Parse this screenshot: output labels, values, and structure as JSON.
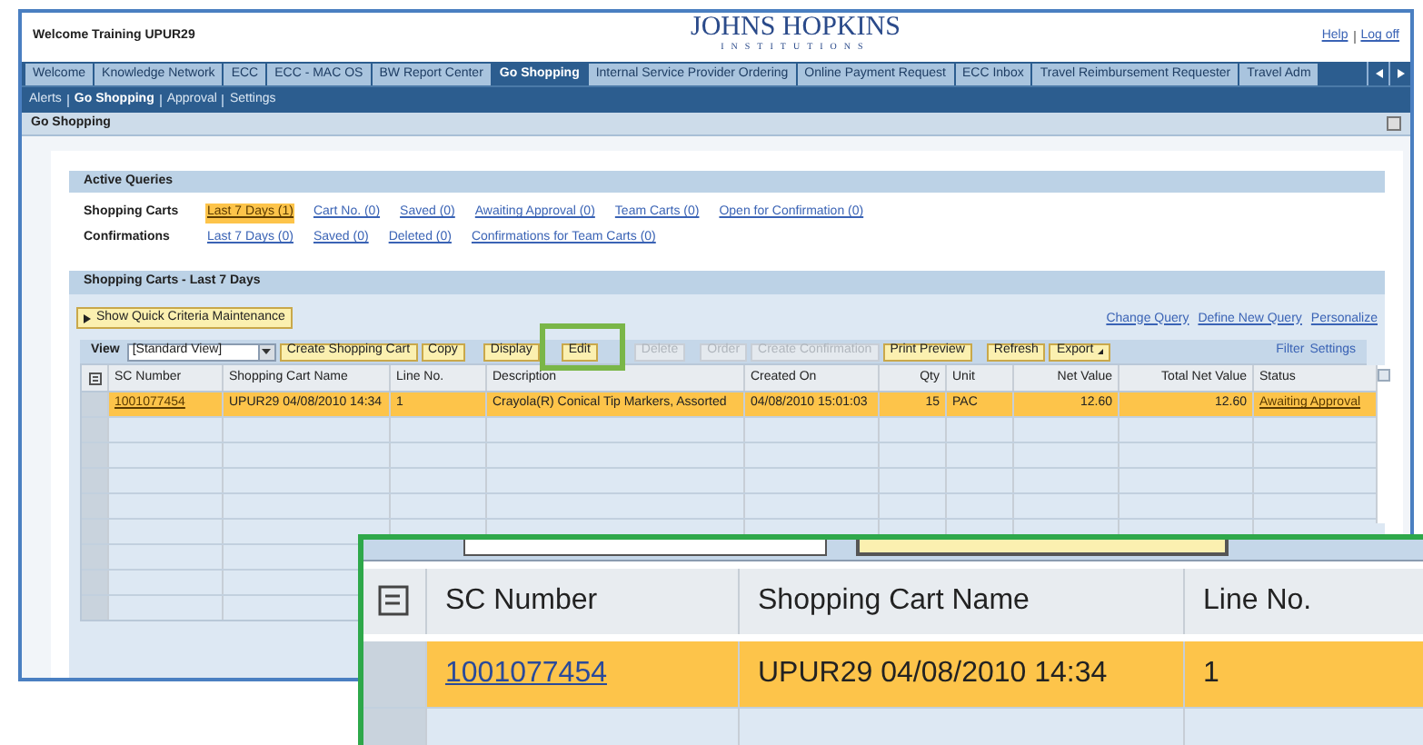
{
  "header": {
    "welcome": "Welcome Training UPUR29",
    "logo_title": "JOHNS HOPKINS",
    "logo_subtitle": "INSTITUTIONS",
    "links": [
      "Help",
      "Log off"
    ]
  },
  "tabs": [
    {
      "label": "Welcome",
      "selected": false
    },
    {
      "label": "Knowledge Network",
      "selected": false
    },
    {
      "label": "ECC",
      "selected": false
    },
    {
      "label": "ECC - MAC OS",
      "selected": false
    },
    {
      "label": "BW Report Center",
      "selected": false
    },
    {
      "label": "Go Shopping",
      "selected": true
    },
    {
      "label": "Internal Service Provider Ordering",
      "selected": false
    },
    {
      "label": "Online Payment Request",
      "selected": false
    },
    {
      "label": "ECC Inbox",
      "selected": false
    },
    {
      "label": "Travel Reimbursement Requester",
      "selected": false
    },
    {
      "label": "Travel Adm",
      "selected": false
    }
  ],
  "subnav": [
    {
      "label": "Alerts",
      "selected": false
    },
    {
      "label": "Go Shopping",
      "selected": true
    },
    {
      "label": "Approval",
      "selected": false
    },
    {
      "label": "Settings",
      "selected": false
    }
  ],
  "page_title": "Go Shopping",
  "active_queries": {
    "title": "Active Queries",
    "rows": [
      {
        "label": "Shopping Carts",
        "links": [
          {
            "label": "Last 7 Days (1)",
            "selected": true
          },
          {
            "label": "Cart No. (0)",
            "selected": false
          },
          {
            "label": "Saved (0)",
            "selected": false
          },
          {
            "label": "Awaiting Approval (0)",
            "selected": false
          },
          {
            "label": "Team Carts (0)",
            "selected": false
          },
          {
            "label": "Open for Confirmation (0)",
            "selected": false
          }
        ]
      },
      {
        "label": "Confirmations",
        "links": [
          {
            "label": "Last 7 Days (0)",
            "selected": false
          },
          {
            "label": "Saved (0)",
            "selected": false
          },
          {
            "label": "Deleted (0)",
            "selected": false
          },
          {
            "label": "Confirmations for Team Carts (0)",
            "selected": false
          }
        ]
      }
    ]
  },
  "carts": {
    "title": "Shopping Carts - Last 7 Days",
    "quick_criteria": "Show Quick Criteria Maintenance",
    "query_links": [
      "Change Query",
      "Define New Query",
      "Personalize"
    ],
    "view_label": "View",
    "view_value": "[Standard View]",
    "toolbar": [
      {
        "label": "Create Shopping Cart",
        "disabled": false
      },
      {
        "label": "Copy",
        "disabled": false
      },
      {
        "label": "Display",
        "disabled": false
      },
      {
        "label": "Edit",
        "disabled": false
      },
      {
        "label": "Delete",
        "disabled": true
      },
      {
        "label": "Order",
        "disabled": true
      },
      {
        "label": "Create Confirmation",
        "disabled": true
      },
      {
        "label": "Print Preview",
        "disabled": false
      },
      {
        "label": "Refresh",
        "disabled": false
      },
      {
        "label": "Export",
        "disabled": false
      }
    ],
    "right_links": [
      "Filter",
      "Settings"
    ],
    "columns": [
      {
        "label": "SC Number",
        "numeric": false
      },
      {
        "label": "Shopping Cart Name",
        "numeric": false
      },
      {
        "label": "Line No.",
        "numeric": false
      },
      {
        "label": "Description",
        "numeric": false
      },
      {
        "label": "Created On",
        "numeric": false
      },
      {
        "label": "Qty",
        "numeric": true
      },
      {
        "label": "Unit",
        "numeric": false
      },
      {
        "label": "Net Value",
        "numeric": true
      },
      {
        "label": "Total Net Value",
        "numeric": true
      },
      {
        "label": "Status",
        "numeric": false
      }
    ],
    "rows": [
      {
        "selected": true,
        "cells": [
          {
            "text": "1001077454",
            "kind": "link"
          },
          {
            "text": "UPUR29 04/08/2010 14:34",
            "kind": "text"
          },
          {
            "text": "1",
            "kind": "text"
          },
          {
            "text": "Crayola(R) Conical Tip Markers, Assorted",
            "kind": "text"
          },
          {
            "text": "04/08/2010 15:01:03",
            "kind": "text"
          },
          {
            "text": "15",
            "kind": "text"
          },
          {
            "text": "PAC",
            "kind": "text"
          },
          {
            "text": "12.60",
            "kind": "text"
          },
          {
            "text": "12.60",
            "kind": "text"
          },
          {
            "text": "Awaiting Approval",
            "kind": "link"
          }
        ]
      }
    ]
  },
  "zoom_inset": {
    "columns": [
      "SC Number",
      "Shopping Cart Name",
      "Line No."
    ],
    "row": {
      "selected": true,
      "cells": [
        {
          "text": "1001077454",
          "kind": "link"
        },
        {
          "text": "UPUR29 04/08/2010 14:34",
          "kind": "text"
        },
        {
          "text": "1",
          "kind": "text"
        }
      ]
    }
  }
}
